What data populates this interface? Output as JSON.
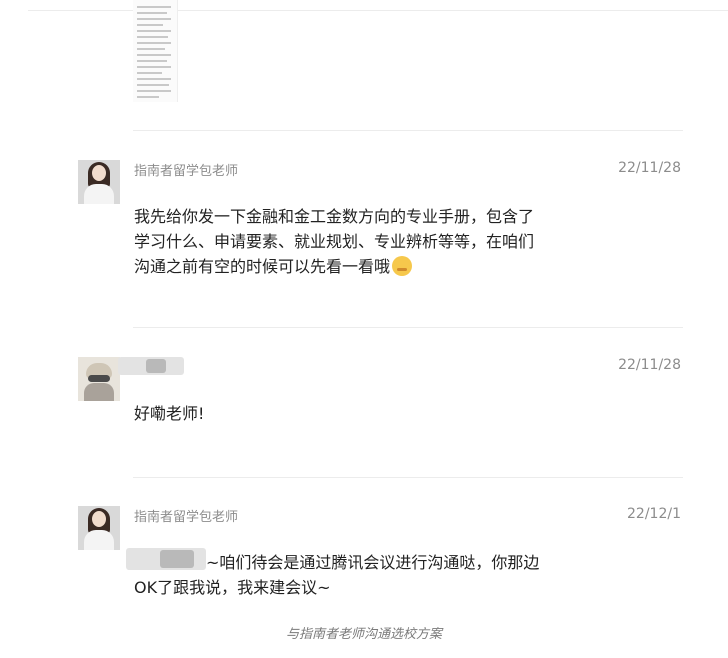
{
  "messages": [
    {
      "sender": "指南者留学包老师",
      "date": "22/11/28",
      "lines": [
        "我先给你发一下金融和金工金数方向的专业手册，包含了",
        "学习什么、申请要素、就业规划、专业辨析等等，在咱们",
        "沟通之前有空的时候可以先看一看哦"
      ]
    },
    {
      "sender": "",
      "date": "22/11/28",
      "lines": [
        "好嘞老师!"
      ]
    },
    {
      "sender": "指南者留学包老师",
      "date": "22/12/1",
      "lines": [
        "~咱们待会是通过腾讯会议进行沟通哒，你那边",
        "OK了跟我说，我来建会议~"
      ]
    }
  ],
  "caption": "与指南者老师沟通选校方案",
  "icons": {
    "teacher_avatar": "teacher-avatar",
    "user_avatar": "user-avatar",
    "emoji": "thinking-face-emoji",
    "document": "document-thumbnail"
  },
  "colors": {
    "text": "#222222",
    "meta": "#8c8c8c",
    "divider": "#ececec"
  }
}
